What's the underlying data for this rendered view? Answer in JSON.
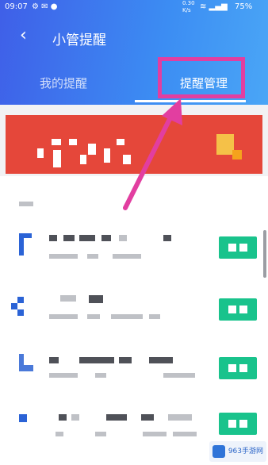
{
  "status_bar": {
    "time": "09:07",
    "battery": "75%",
    "net_speed": "0.30 K/s"
  },
  "nav": {
    "back_icon": "‹",
    "title": "小管提醒"
  },
  "tabs": [
    {
      "label": "我的提醒"
    },
    {
      "label": "提醒管理"
    }
  ],
  "watermark": {
    "text": "963手游网"
  },
  "colors": {
    "header": "#3f5fe8",
    "highlight": "#e23ea0",
    "banner": "#e5473a",
    "accent_button": "#19c38c"
  }
}
